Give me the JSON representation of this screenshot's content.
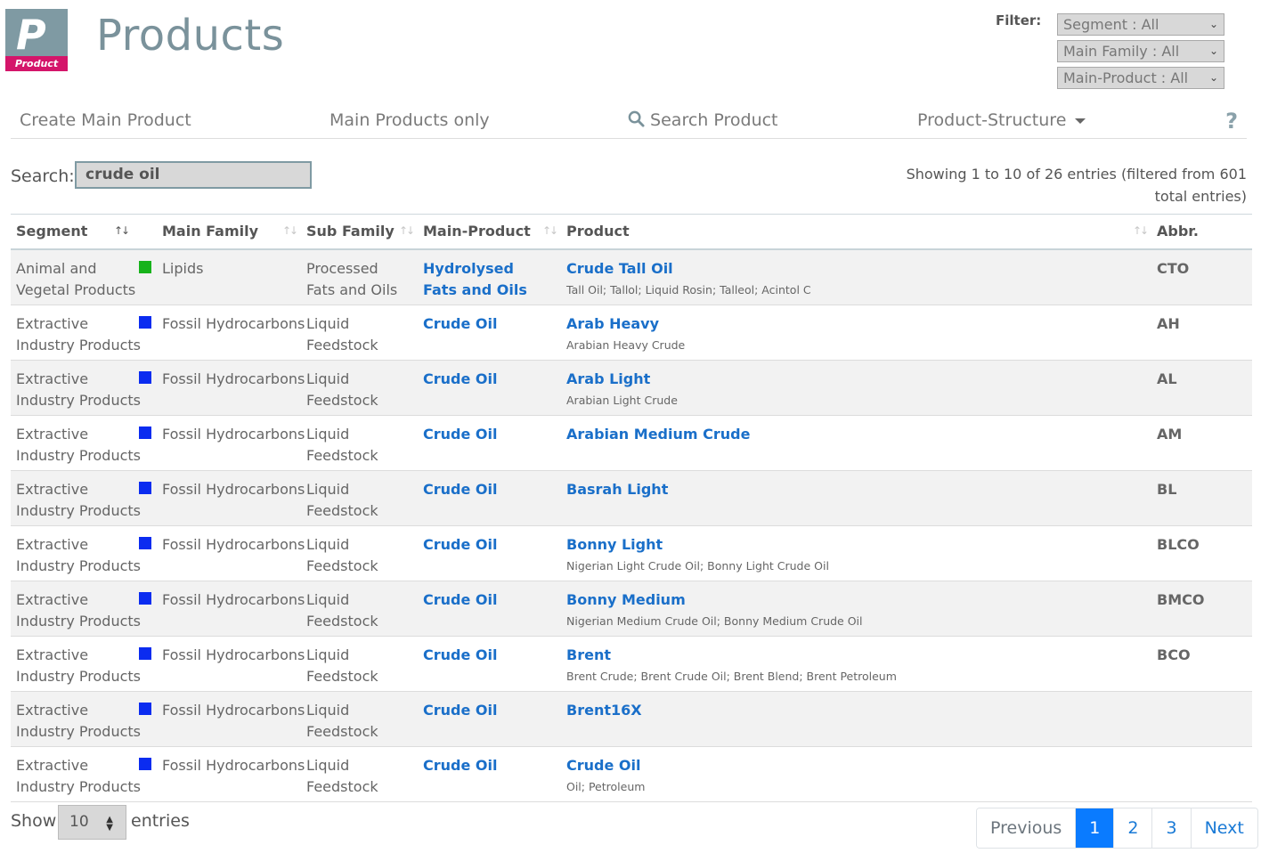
{
  "logo": {
    "letter": "P",
    "band": "Product"
  },
  "page_title": "Products",
  "filter": {
    "label": "Filter:",
    "selects": [
      "Segment : All",
      "Main Family : All",
      "Main-Product : All"
    ]
  },
  "nav": {
    "create": "Create Main Product",
    "main_only": "Main Products only",
    "search": "Search Product",
    "structure": "Product-Structure",
    "help": "?"
  },
  "search": {
    "label": "Search:",
    "value": "crude oil"
  },
  "showing": "Showing 1 to 10 of 26 entries (filtered from 601 total entries)",
  "columns": [
    "Segment",
    "Main Family",
    "Sub Family",
    "Main-Product",
    "Product",
    "Abbr."
  ],
  "colors": {
    "lipids": "#17b31b",
    "fossil": "#0b2cf0",
    "link": "#1a6fc9",
    "active_page": "#0a7bff"
  },
  "rows": [
    {
      "segment": "Animal and Vegetal Products",
      "family_color": "#17b31b",
      "family": "Lipids",
      "sub": "Processed Fats and Oils",
      "main": "Hydrolysed Fats and Oils",
      "product": "Crude Tall Oil",
      "syn": "Tall Oil; Tallol; Liquid Rosin; Talleol; Acintol C",
      "abbr": "CTO"
    },
    {
      "segment": "Extractive Industry Products",
      "family_color": "#0b2cf0",
      "family": "Fossil Hydrocarbons",
      "sub": "Liquid Feedstock",
      "main": "Crude Oil",
      "product": "Arab Heavy",
      "syn": "Arabian Heavy Crude",
      "abbr": "AH"
    },
    {
      "segment": "Extractive Industry Products",
      "family_color": "#0b2cf0",
      "family": "Fossil Hydrocarbons",
      "sub": "Liquid Feedstock",
      "main": "Crude Oil",
      "product": "Arab Light",
      "syn": "Arabian Light Crude",
      "abbr": "AL"
    },
    {
      "segment": "Extractive Industry Products",
      "family_color": "#0b2cf0",
      "family": "Fossil Hydrocarbons",
      "sub": "Liquid Feedstock",
      "main": "Crude Oil",
      "product": "Arabian Medium Crude",
      "syn": "",
      "abbr": "AM"
    },
    {
      "segment": "Extractive Industry Products",
      "family_color": "#0b2cf0",
      "family": "Fossil Hydrocarbons",
      "sub": "Liquid Feedstock",
      "main": "Crude Oil",
      "product": "Basrah Light",
      "syn": "",
      "abbr": "BL"
    },
    {
      "segment": "Extractive Industry Products",
      "family_color": "#0b2cf0",
      "family": "Fossil Hydrocarbons",
      "sub": "Liquid Feedstock",
      "main": "Crude Oil",
      "product": "Bonny Light",
      "syn": "Nigerian Light Crude Oil; Bonny Light Crude Oil",
      "abbr": "BLCO"
    },
    {
      "segment": "Extractive Industry Products",
      "family_color": "#0b2cf0",
      "family": "Fossil Hydrocarbons",
      "sub": "Liquid Feedstock",
      "main": "Crude Oil",
      "product": "Bonny Medium",
      "syn": "Nigerian Medium Crude Oil; Bonny Medium Crude Oil",
      "abbr": "BMCO"
    },
    {
      "segment": "Extractive Industry Products",
      "family_color": "#0b2cf0",
      "family": "Fossil Hydrocarbons",
      "sub": "Liquid Feedstock",
      "main": "Crude Oil",
      "product": "Brent",
      "syn": "Brent Crude; Brent Crude Oil; Brent Blend; Brent Petroleum",
      "abbr": "BCO"
    },
    {
      "segment": "Extractive Industry Products",
      "family_color": "#0b2cf0",
      "family": "Fossil Hydrocarbons",
      "sub": "Liquid Feedstock",
      "main": "Crude Oil",
      "product": "Brent16X",
      "syn": "",
      "abbr": ""
    },
    {
      "segment": "Extractive Industry Products",
      "family_color": "#0b2cf0",
      "family": "Fossil Hydrocarbons",
      "sub": "Liquid Feedstock",
      "main": "Crude Oil",
      "product": "Crude Oil",
      "syn": "Oil; Petroleum",
      "abbr": ""
    }
  ],
  "footer": {
    "show": "Show",
    "length": "10",
    "entries": "entries",
    "pages": [
      "Previous",
      "1",
      "2",
      "3",
      "Next"
    ]
  }
}
